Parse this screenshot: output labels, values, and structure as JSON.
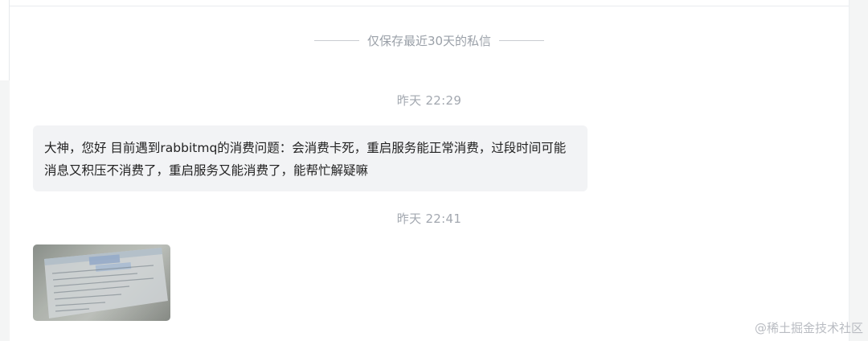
{
  "chat": {
    "notice": "仅保存最近30天的私信",
    "messages": [
      {
        "time": "昨天 22:29",
        "text": "大神，您好 目前遇到rabbitmq的消费问题：会消费卡死，重启服务能正常消费，过段时间可能消息又积压不消费了，重启服务又能消费了，能帮忙解疑嘛"
      },
      {
        "time": "昨天 22:41",
        "image_icon": "photo-screenshot"
      }
    ]
  },
  "watermark": "@稀土掘金技术社区",
  "colors": {
    "bubble_bg": "#f2f3f5",
    "page_bg": "#ffffff",
    "muted_text": "#9aa0a8"
  }
}
